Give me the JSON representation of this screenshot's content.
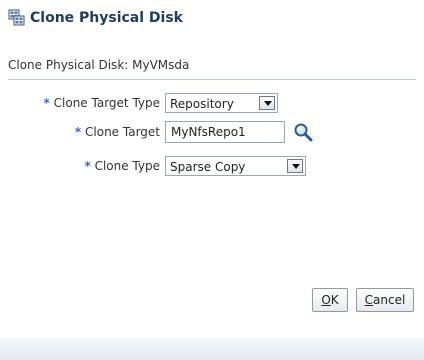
{
  "dialog": {
    "title": "Clone Physical Disk",
    "icon": "clone-disk-icon"
  },
  "header": {
    "label": "Clone Physical Disk: MyVMsda"
  },
  "form": {
    "required_marker": "*",
    "clone_target_type": {
      "label": "Clone Target Type",
      "value": "Repository"
    },
    "clone_target": {
      "label": "Clone Target",
      "value": "MyNfsRepo1",
      "search_icon": "search-icon"
    },
    "clone_type": {
      "label": "Clone Type",
      "value": "Sparse Copy"
    }
  },
  "buttons": {
    "ok_mnemonic": "O",
    "ok_rest": "K",
    "cancel_mnemonic": "C",
    "cancel_rest": "ancel"
  },
  "colors": {
    "title": "#1f3c5e",
    "required": "#3a6ea5",
    "separator": "#c4ced7"
  }
}
